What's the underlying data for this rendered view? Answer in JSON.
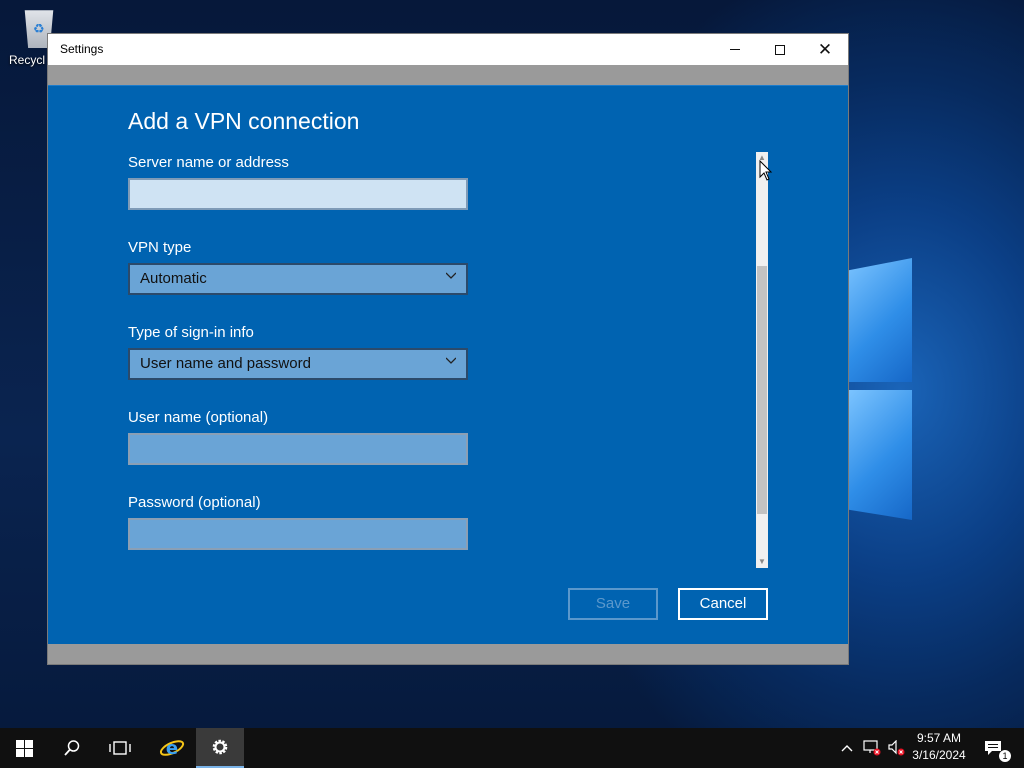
{
  "desktop": {
    "icons": [
      {
        "label": "Recycl",
        "icon": "recycle-bin-icon"
      }
    ]
  },
  "window": {
    "title": "Settings",
    "controls": {
      "minimize": "minimize-icon",
      "maximize": "maximize-icon",
      "close": "close-icon"
    }
  },
  "dialog": {
    "title": "Add a VPN connection",
    "fields": {
      "server": {
        "label": "Server name or address",
        "value": ""
      },
      "vpn_type": {
        "label": "VPN type",
        "value": "Automatic"
      },
      "signin_type": {
        "label": "Type of sign-in info",
        "value": "User name and password"
      },
      "username": {
        "label": "User name (optional)",
        "value": ""
      },
      "password": {
        "label": "Password (optional)",
        "value": ""
      }
    },
    "buttons": {
      "save": "Save",
      "cancel": "Cancel"
    },
    "save_enabled": false
  },
  "taskbar": {
    "items": [
      "start-icon",
      "search-icon",
      "task-view-icon",
      "internet-explorer-icon",
      "settings-gear-icon"
    ],
    "active": "settings-gear-icon",
    "tray": {
      "icons": [
        "chevron-up-icon",
        "network-error-icon",
        "volume-muted-icon",
        "action-center-icon"
      ]
    },
    "clock": {
      "time": "9:57 AM",
      "date": "3/16/2024"
    },
    "notifications_count": "1"
  },
  "colors": {
    "dialog_bg": "#0063b1",
    "accent": "#0078d7",
    "taskbar_bg": "#101010"
  }
}
